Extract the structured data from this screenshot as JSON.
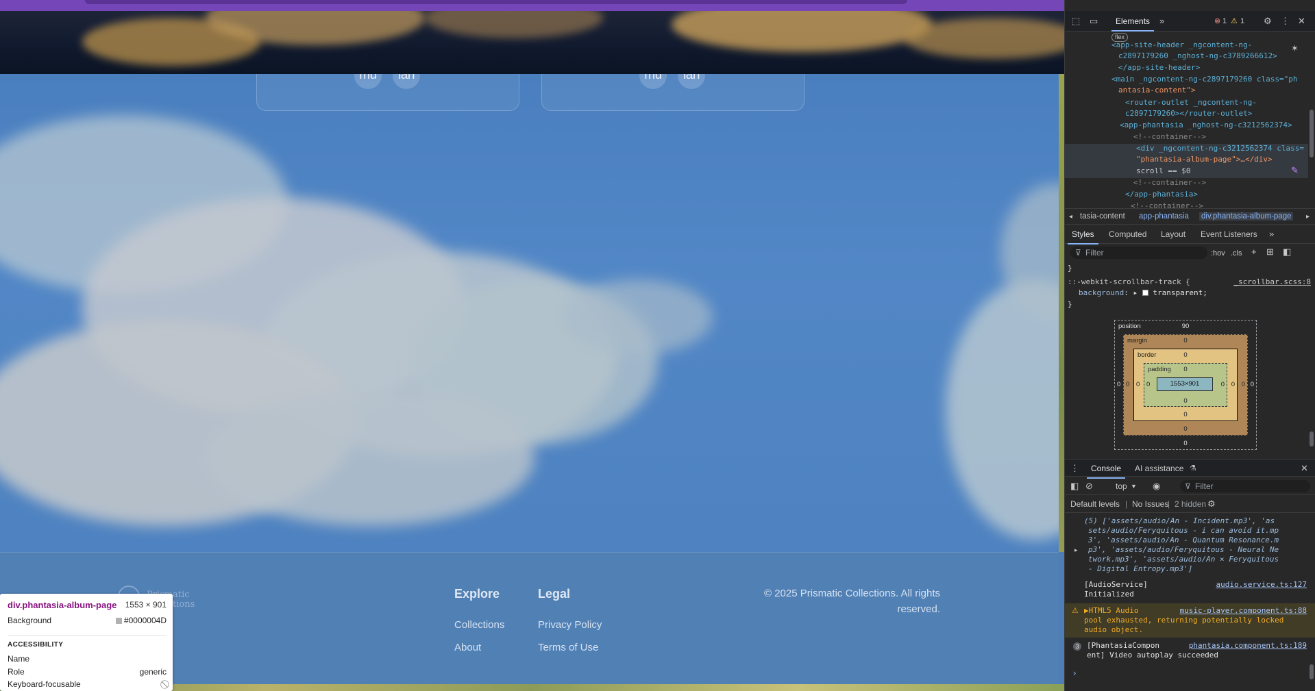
{
  "page": {
    "cards": [
      {
        "chip1": "mu",
        "chip2": "lan"
      },
      {
        "chip1": "mu",
        "chip2": "lan"
      }
    ],
    "footer": {
      "logo_line1": "Prismatic",
      "logo_line2": "tions",
      "explore_heading": "Explore",
      "explore_links": [
        "Collections",
        "About"
      ],
      "legal_heading": "Legal",
      "legal_links": [
        "Privacy Policy",
        "Terms of Use"
      ],
      "copyright": "© 2025 Prismatic Collections. All rights reserved."
    }
  },
  "tooltip": {
    "element": "div.phantasia-album-page",
    "size": "1553 × 901",
    "background_label": "Background",
    "background_value": "#0000004D",
    "accessibility_heading": "ACCESSIBILITY",
    "name_label": "Name",
    "role_label": "Role",
    "role_value": "generic",
    "focusable_label": "Keyboard-focusable"
  },
  "devtools": {
    "main_tab": "Elements",
    "error_count": "1",
    "warning_count": "1",
    "dom_lines": [
      {
        "kind": "badge",
        "text": "flex"
      },
      {
        "kind": "tag",
        "text": "<app-site-header _ngcontent-ng-"
      },
      {
        "kind": "tag",
        "text": "c2897179260 _nghost-ng-c3789266612>"
      },
      {
        "kind": "tag",
        "text": "</app-site-header>"
      },
      {
        "kind": "tag",
        "text": "<main _ngcontent-ng-c2897179260 class=\"ph"
      },
      {
        "kind": "tag",
        "text": "antasia-content\">"
      },
      {
        "kind": "tag",
        "text": "<router-outlet _ngcontent-ng-"
      },
      {
        "kind": "tag",
        "text": "c2897179260></router-outlet>"
      },
      {
        "kind": "tag",
        "text": "<app-phantasia _nghost-ng-c3212562374>"
      },
      {
        "kind": "comment",
        "text": "<!--container-->"
      },
      {
        "kind": "tag",
        "text": "<div _ngcontent-ng-c3212562374 class="
      },
      {
        "kind": "tag",
        "text": "\"phantasia-album-page\">…</div>"
      },
      {
        "kind": "tag",
        "text": "scroll == $0"
      },
      {
        "kind": "comment",
        "text": "<!--container-->"
      },
      {
        "kind": "tag",
        "text": "</app-phantasia>"
      },
      {
        "kind": "comment",
        "text": "<!--container-->"
      }
    ],
    "breadcrumbs": [
      "tasia-content",
      "app-phantasia",
      "div.phantasia-album-page"
    ],
    "style_tabs": [
      "Styles",
      "Computed",
      "Layout",
      "Event Listeners"
    ],
    "filter_placeholder": "Filter",
    "hov": ":hov",
    "cls": ".cls",
    "css_rule_selector": "::-webkit-scrollbar-track {",
    "css_rule_source": "_scrollbar.scss:8",
    "css_prop": "background",
    "css_value": "transparent;",
    "box_model": {
      "position_label": "position",
      "position_value": "90",
      "margin_label": "margin",
      "border_label": "border",
      "padding_label": "padding",
      "content": "1553×901",
      "zero": "0"
    },
    "drawer_tabs": [
      "Console",
      "AI assistance"
    ],
    "context": "top",
    "console_filter": "Filter",
    "levels": "Default levels",
    "issues": "No Issues",
    "hidden": "2 hidden",
    "console": {
      "array_lines": [
        "(5) ['assets/audio/An - Incident.mp3', 'as",
        "sets/audio/Feryquitous - i can avoid it.mp",
        "3', 'assets/audio/An - Quantum Resonance.m",
        "p3', 'assets/audio/Feryquitous - Neural Ne",
        "twork.mp3', 'assets/audio/An × Feryquitous",
        " - Digital Entropy.mp3']"
      ],
      "audio_service": "[AudioService]",
      "audio_service_link": "audio.service.ts:127",
      "initialized": "Initialized",
      "warn_prefix": "▶HTML5 Audio",
      "warn_link": "music-player.component.ts:88",
      "warn_line2": "pool exhausted, returning potentially locked",
      "warn_line3": "audio object.",
      "log_count": "3",
      "phantasia_prefix": "[PhantasiaCompon",
      "phantasia_link": "phantasia.component.ts:189",
      "phantasia_line2": "ent] Video autoplay succeeded"
    }
  }
}
